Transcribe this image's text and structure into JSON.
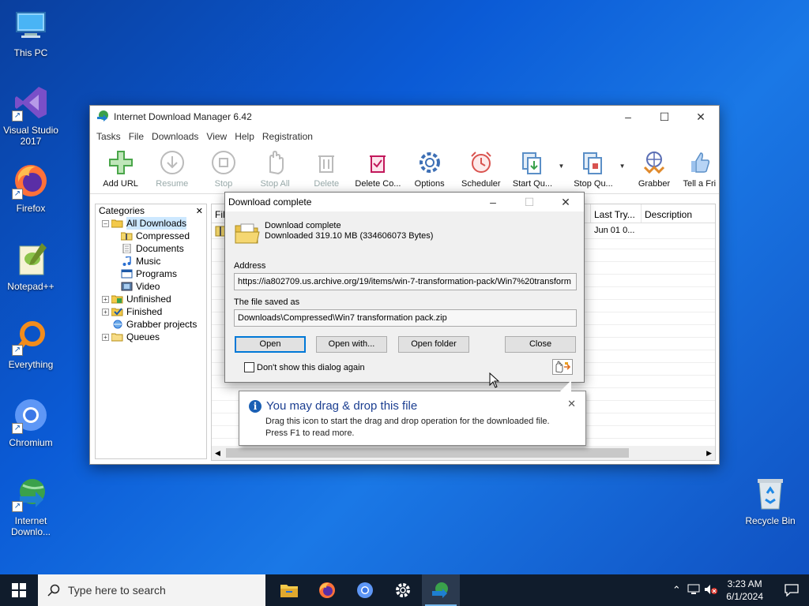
{
  "desktop": {
    "icons": [
      {
        "label": "This PC"
      },
      {
        "label": "Visual Studio 2017"
      },
      {
        "label": "Firefox"
      },
      {
        "label": "Notepad++"
      },
      {
        "label": "Everything"
      },
      {
        "label": "Chromium"
      },
      {
        "label": "Internet Downlo..."
      },
      {
        "label": "Recycle Bin"
      }
    ]
  },
  "idm": {
    "title": "Internet Download Manager 6.42",
    "menu": [
      "Tasks",
      "File",
      "Downloads",
      "View",
      "Help",
      "Registration"
    ],
    "toolbar": [
      {
        "label": "Add URL",
        "enabled": true
      },
      {
        "label": "Resume",
        "enabled": false
      },
      {
        "label": "Stop",
        "enabled": false
      },
      {
        "label": "Stop All",
        "enabled": false
      },
      {
        "label": "Delete",
        "enabled": false
      },
      {
        "label": "Delete Co...",
        "enabled": true
      },
      {
        "label": "Options",
        "enabled": true
      },
      {
        "label": "Scheduler",
        "enabled": true
      },
      {
        "label": "Start Qu...",
        "enabled": true
      },
      {
        "label": "Stop Qu...",
        "enabled": true
      },
      {
        "label": "Grabber",
        "enabled": true
      },
      {
        "label": "Tell a Fri",
        "enabled": true
      }
    ],
    "categories": {
      "header": "Categories",
      "close": "✕",
      "tree": {
        "all": "All Downloads",
        "compressed": "Compressed",
        "documents": "Documents",
        "music": "Music",
        "programs": "Programs",
        "video": "Video",
        "unfinished": "Unfinished",
        "finished": "Finished",
        "grabber": "Grabber projects",
        "queues": "Queues"
      }
    },
    "list": {
      "columns": {
        "file": "Fil",
        "last_try": "Last Try...",
        "description": "Description"
      },
      "rows": [
        {
          "last_try": "Jun 01 0..."
        }
      ]
    }
  },
  "dialog": {
    "title": "Download complete",
    "status_line1": "Download complete",
    "status_line2": "Downloaded 319.10  MB (334606073 Bytes)",
    "address_label": "Address",
    "address_value": "https://ia802709.us.archive.org/19/items/win-7-transformation-pack/Win7%20transform",
    "saved_label": "The file saved as",
    "saved_value": "Downloads\\Compressed\\Win7 transformation pack.zip",
    "buttons": {
      "open": "Open",
      "open_with": "Open with...",
      "open_folder": "Open folder",
      "close": "Close"
    },
    "dont_show": "Don't show this dialog again"
  },
  "balloon": {
    "title": "You may drag & drop this file",
    "line1": "Drag this icon to start the drag and drop operation for the downloaded file.",
    "line2": "Press F1 to read more.",
    "close": "✕"
  },
  "taskbar": {
    "search_placeholder": "Type here to search",
    "time": "3:23 AM",
    "date": "6/1/2024"
  }
}
